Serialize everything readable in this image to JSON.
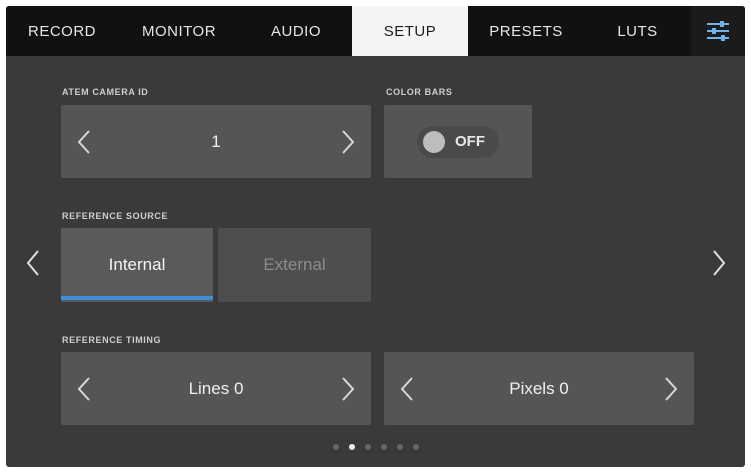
{
  "tabs": [
    {
      "label": "RECORD"
    },
    {
      "label": "MONITOR"
    },
    {
      "label": "AUDIO"
    },
    {
      "label": "SETUP"
    },
    {
      "label": "PRESETS"
    },
    {
      "label": "LUTS"
    }
  ],
  "active_tab": "SETUP",
  "settings_icon": "sliders-icon",
  "atem": {
    "label": "ATEM CAMERA ID",
    "value": "1"
  },
  "color_bars": {
    "label": "COLOR BARS",
    "state": "OFF"
  },
  "reference_source": {
    "label": "REFERENCE SOURCE",
    "options": [
      "Internal",
      "External"
    ],
    "selected": "Internal"
  },
  "reference_timing": {
    "label": "REFERENCE TIMING",
    "lines": "Lines 0",
    "pixels": "Pixels 0"
  },
  "pagination": {
    "total": 6,
    "current": 2
  },
  "colors": {
    "accent": "#3d8fd8",
    "tab_active_bg": "#f4f4f4",
    "panel": "#555555",
    "background": "#3a3a3a"
  }
}
